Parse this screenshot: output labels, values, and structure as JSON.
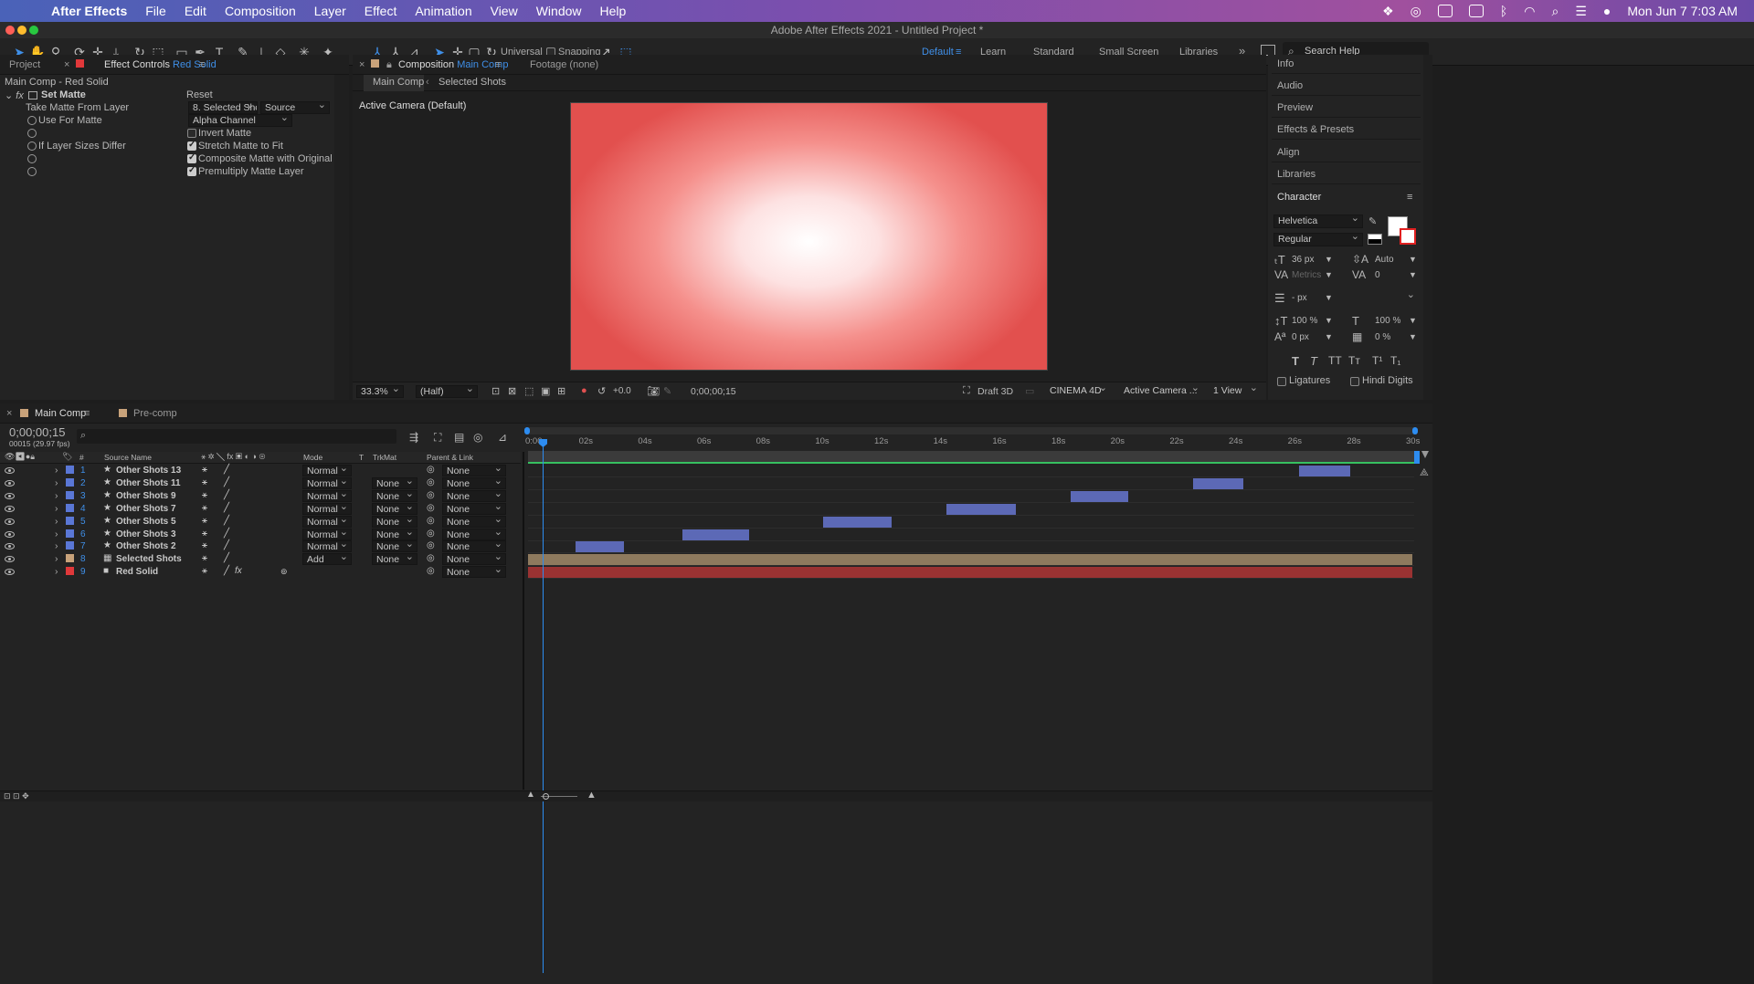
{
  "menubar": {
    "app": "After Effects",
    "items": [
      "File",
      "Edit",
      "Composition",
      "Layer",
      "Effect",
      "Animation",
      "View",
      "Window",
      "Help"
    ],
    "datetime": "Mon Jun 7  7:03 AM"
  },
  "window": {
    "title": "Adobe After Effects 2021 - Untitled Project *"
  },
  "toolbar": {
    "universal": "Universal",
    "snapping": "Snapping",
    "workspaces": [
      "Default",
      "Learn",
      "Standard",
      "Small Screen",
      "Libraries"
    ],
    "search_placeholder": "Search Help"
  },
  "effect_controls": {
    "tab_project": "Project",
    "tab_label": "Effect Controls",
    "tab_layer": "Red Solid",
    "header": "Main Comp - Red Solid",
    "effect_name": "Set Matte",
    "reset": "Reset",
    "props": {
      "take_matte": "Take Matte From Layer",
      "take_matte_value": "8. Selected Shc",
      "take_matte_source": "Source",
      "use_for_matte": "Use For Matte",
      "use_for_matte_value": "Alpha Channel",
      "invert_matte": "Invert Matte",
      "if_layer_sizes": "If Layer Sizes Differ",
      "stretch": "Stretch Matte to Fit",
      "composite": "Composite Matte with Original",
      "premultiply": "Premultiply Matte Layer"
    }
  },
  "composition": {
    "tab_label": "Composition",
    "tab_name": "Main Comp",
    "footage": "Footage (none)",
    "crumb_main": "Main Comp",
    "crumb_selected": "Selected Shots",
    "camera_label": "Active Camera (Default)",
    "zoom": "33.3%",
    "resolution": "(Half)",
    "exposure": "+0.0",
    "timecode": "0;00;00;15",
    "draft3d": "Draft 3D",
    "renderer": "CINEMA 4D",
    "camera": "Active Camera ...",
    "views": "1 View"
  },
  "right_panel": {
    "items": [
      "Info",
      "Audio",
      "Preview",
      "Effects & Presets",
      "Align",
      "Libraries"
    ],
    "character": {
      "title": "Character",
      "font": "Helvetica",
      "style": "Regular",
      "size": "36 px",
      "leading": "Auto",
      "kerning": "Metrics",
      "tracking": "0",
      "stroke": "- px",
      "vscale": "100 %",
      "hscale": "100 %",
      "baseline": "0 px",
      "tsume": "0 %",
      "ligatures": "Ligatures",
      "hindi": "Hindi Digits"
    }
  },
  "timeline": {
    "tab_main": "Main Comp",
    "tab_precomp": "Pre-comp",
    "timecode": "0;00;00;15",
    "frames": "00015 (29.97 fps)",
    "cols": {
      "num": "#",
      "source": "Source Name",
      "mode": "Mode",
      "t": "T",
      "trkmat": "TrkMat",
      "parent": "Parent & Link"
    },
    "ticks": [
      "0:00s",
      "02s",
      "04s",
      "06s",
      "08s",
      "10s",
      "12s",
      "14s",
      "16s",
      "18s",
      "20s",
      "22s",
      "24s",
      "26s",
      "28s",
      "30s"
    ],
    "layers": [
      {
        "num": "1",
        "name": "Other Shots 13",
        "mode": "Normal",
        "trkmat": "",
        "parent": "None",
        "color": "#5a77d6"
      },
      {
        "num": "2",
        "name": "Other Shots 11",
        "mode": "Normal",
        "trkmat": "None",
        "parent": "None",
        "color": "#5a77d6"
      },
      {
        "num": "3",
        "name": "Other Shots 9",
        "mode": "Normal",
        "trkmat": "None",
        "parent": "None",
        "color": "#5a77d6"
      },
      {
        "num": "4",
        "name": "Other Shots 7",
        "mode": "Normal",
        "trkmat": "None",
        "parent": "None",
        "color": "#5a77d6"
      },
      {
        "num": "5",
        "name": "Other Shots 5",
        "mode": "Normal",
        "trkmat": "None",
        "parent": "None",
        "color": "#5a77d6"
      },
      {
        "num": "6",
        "name": "Other Shots 3",
        "mode": "Normal",
        "trkmat": "None",
        "parent": "None",
        "color": "#5a77d6"
      },
      {
        "num": "7",
        "name": "Other Shots 2",
        "mode": "Normal",
        "trkmat": "None",
        "parent": "None",
        "color": "#5a77d6"
      },
      {
        "num": "8",
        "name": "Selected Shots",
        "mode": "Add",
        "trkmat": "None",
        "parent": "None",
        "color": "#c8a27a"
      },
      {
        "num": "9",
        "name": "Red Solid",
        "mode": "",
        "trkmat": "",
        "parent": "None",
        "color": "#e0383a"
      }
    ]
  }
}
